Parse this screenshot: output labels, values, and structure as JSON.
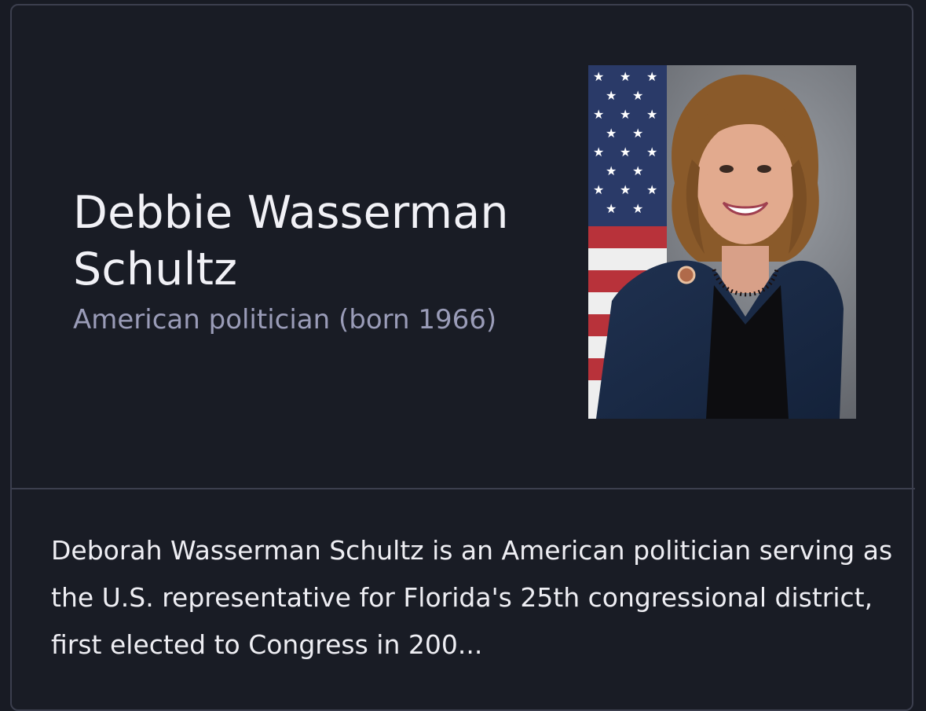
{
  "entity": {
    "name": "Debbie Wasserman Schultz",
    "subtitle": "American politician (born 1966)",
    "description": "Deborah Wasserman Schultz is an American politician serving as the U.S. representative for Florida's 25th congressional district, first elected to Congress in 200..."
  },
  "portrait": {
    "icon": "person-portrait-image",
    "background_color": "#7c8086"
  },
  "colors": {
    "page_background": "#181b24",
    "card_border": "#3c3f4e",
    "title_text": "#f1f1f6",
    "subtitle_text": "#9a9cb8"
  }
}
